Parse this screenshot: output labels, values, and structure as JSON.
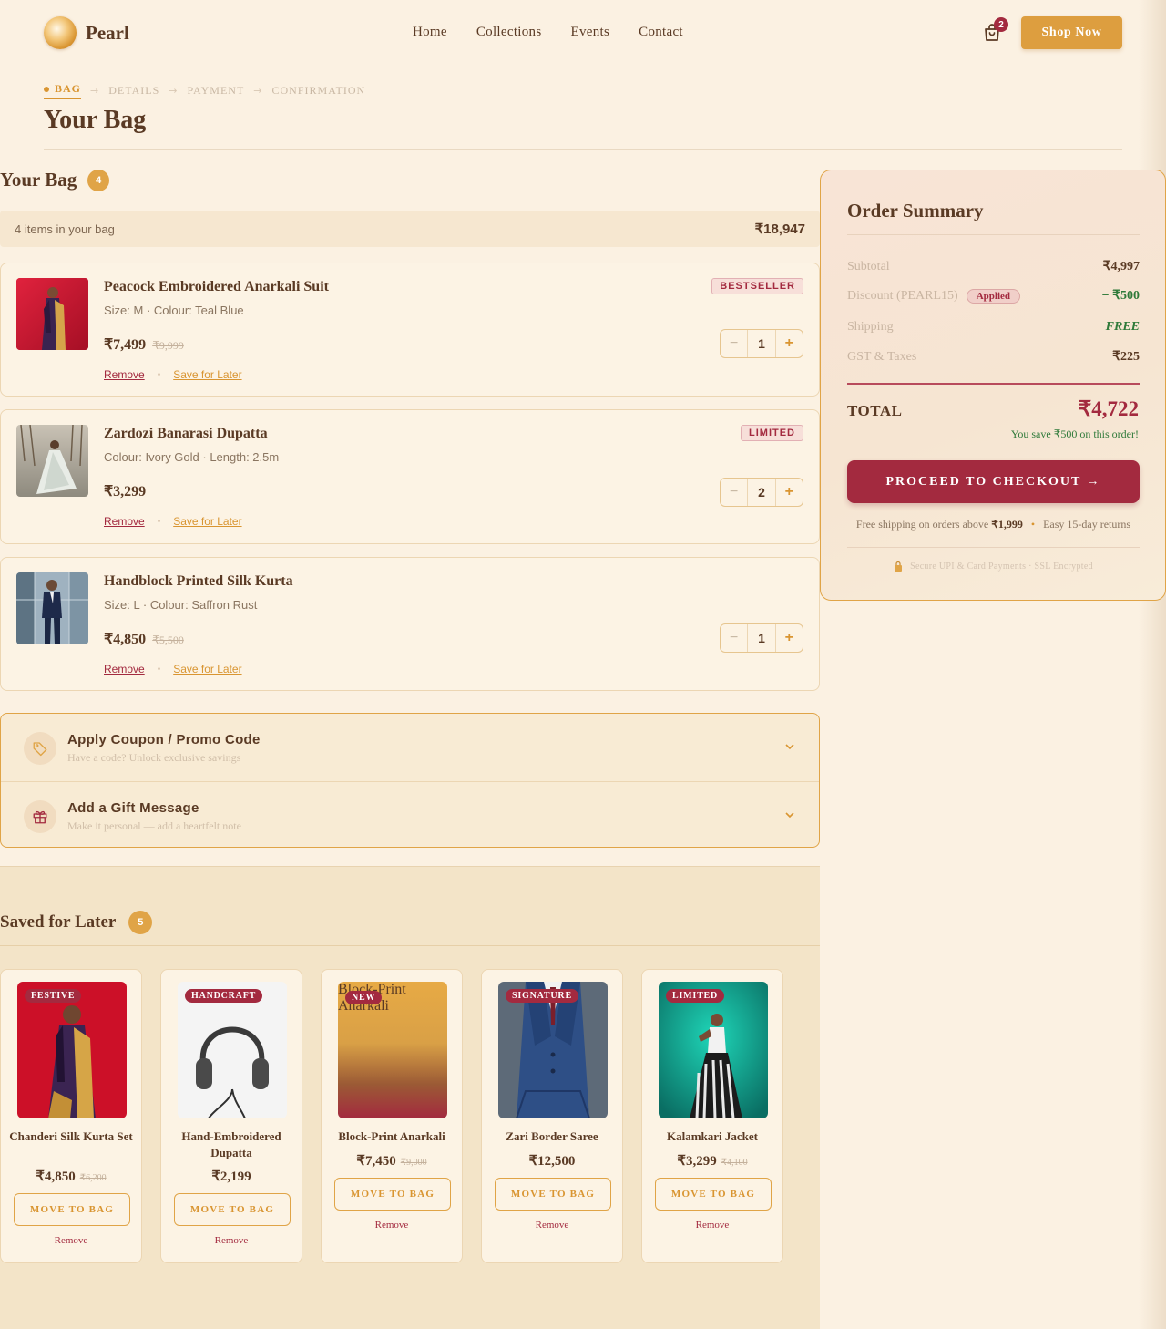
{
  "brand": {
    "name": "Pearl"
  },
  "nav": {
    "items": [
      "Home",
      "Collections",
      "Events",
      "Contact"
    ]
  },
  "cart": {
    "count": "2"
  },
  "header": {
    "shop_now": "Shop Now"
  },
  "steps": {
    "bag": "BAG",
    "details": "DETAILS",
    "payment": "PAYMENT",
    "confirmation": "CONFIRMATION",
    "arrow": "→"
  },
  "page": {
    "title": "Your Bag"
  },
  "bag": {
    "heading": "Your Bag",
    "count": "4",
    "items_text": "4 items in your bag",
    "items_total": "₹18,947",
    "items": [
      {
        "name": "Peacock Embroidered Anarkali Suit",
        "meta": "Size: M · Colour: Teal Blue",
        "price": "₹7,499",
        "old_price": "₹9,999",
        "tag": "BESTSELLER",
        "qty": "1",
        "remove": "Remove",
        "save": "Save for Later"
      },
      {
        "name": "Zardozi Banarasi Dupatta",
        "meta": "Colour: Ivory Gold · Length: 2.5m",
        "price": "₹3,299",
        "old_price": "",
        "tag": "LIMITED",
        "qty": "2",
        "remove": "Remove",
        "save": "Save for Later"
      },
      {
        "name": "Handblock Printed Silk Kurta",
        "meta": "Size: L · Colour: Saffron Rust",
        "price": "₹4,850",
        "old_price": "₹5,500",
        "tag": "",
        "qty": "1",
        "remove": "Remove",
        "save": "Save for Later"
      }
    ],
    "qty_minus": "−",
    "qty_plus": "+",
    "dot": "•"
  },
  "extras": {
    "coupon": {
      "title": "Apply Coupon / Promo Code",
      "sub": "Have a code? Unlock exclusive savings"
    },
    "gift": {
      "title": "Add a Gift Message",
      "sub": "Make it personal — add a heartfelt note"
    }
  },
  "saved": {
    "heading": "Saved for Later",
    "count": "5",
    "move_label": "MOVE TO BAG",
    "remove_label": "Remove",
    "items": [
      {
        "name": "Chanderi Silk Kurta Set",
        "tag": "FESTIVE",
        "price": "₹4,850",
        "old_price": "₹6,200"
      },
      {
        "name": "Hand-Embroidered Dupatta",
        "tag": "HANDCRAFT",
        "price": "₹2,199",
        "old_price": ""
      },
      {
        "name": "Block-Print Anarkali",
        "tag": "NEW",
        "price": "₹7,450",
        "old_price": "₹9,000",
        "broken_alt": "Block-Print Anarkali"
      },
      {
        "name": "Zari Border Saree",
        "tag": "SIGNATURE",
        "price": "₹12,500",
        "old_price": ""
      },
      {
        "name": "Kalamkari Jacket",
        "tag": "LIMITED",
        "price": "₹3,299",
        "old_price": "₹4,100"
      }
    ]
  },
  "summary": {
    "title": "Order Summary",
    "subtotal_label": "Subtotal",
    "subtotal": "₹4,997",
    "discount_label": "Discount (PEARL15)",
    "applied": "Applied",
    "discount": "− ₹500",
    "shipping_label": "Shipping",
    "shipping": "FREE",
    "gst_label": "GST & Taxes",
    "gst": "₹225",
    "total_label": "TOTAL",
    "total": "₹4,722",
    "save_note": "You save ₹500 on this order!",
    "checkout": "PROCEED TO CHECKOUT  →",
    "ship_note_pre": "Free shipping on orders above",
    "ship_note_amount": "₹1,999",
    "ship_note_dot": "•",
    "ship_note_returns": "Easy 15-day returns",
    "secure": "Secure UPI & Card Payments · SSL Encrypted"
  },
  "colors": {
    "accent": "#dd9e3f",
    "brand_red": "#a32a3f",
    "background": "#fbf1e2",
    "success": "#2f7a3a"
  }
}
